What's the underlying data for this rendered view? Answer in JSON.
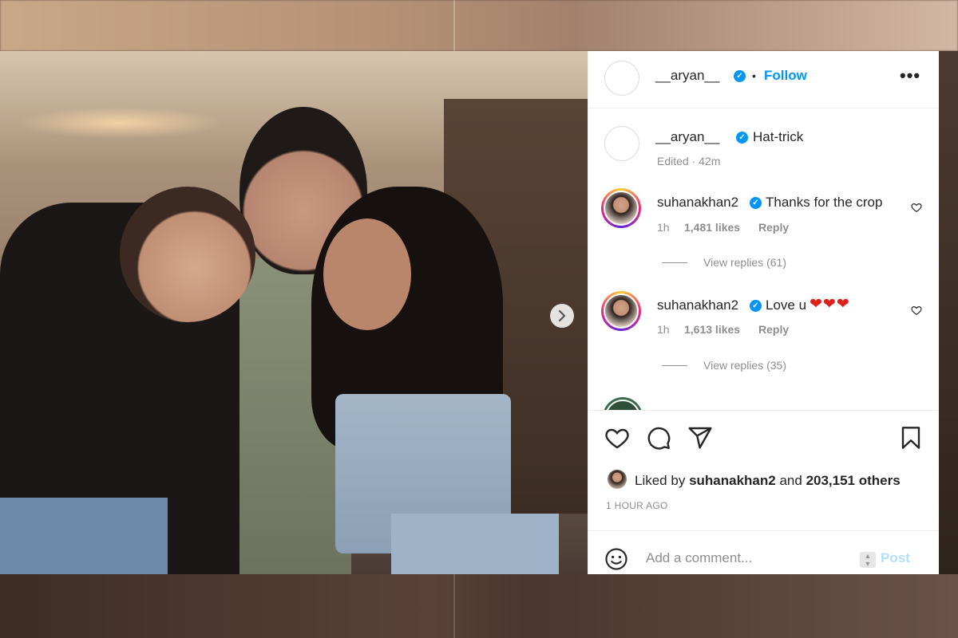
{
  "post": {
    "author": "__aryan__",
    "follow_label": "Follow",
    "bullet": "•",
    "more_label": "•••",
    "caption": {
      "username": "__aryan__",
      "text": "Hat-trick",
      "meta": "Edited · 42m"
    },
    "comments": [
      {
        "username": "suhanakhan2",
        "text": "Thanks for the crop",
        "time": "1h",
        "likes": "1,481 likes",
        "reply_label": "Reply",
        "view_replies": "View replies (61)"
      },
      {
        "username": "suhanakhan2",
        "text": "Love u",
        "hearts": "❤❤❤",
        "time": "1h",
        "likes": "1,613 likes",
        "reply_label": "Reply",
        "view_replies": "View replies (35)"
      }
    ],
    "liked_by": {
      "prefix": "Liked by",
      "user": "suhanakhan2",
      "middle": "and",
      "others": "203,151 others"
    },
    "time_ago": "1 HOUR AGO",
    "add_comment_placeholder": "Add a comment...",
    "post_label": "Post",
    "carousel": {
      "total_slides": 2,
      "current_slide": 1
    }
  },
  "colors": {
    "accent": "#0095f6",
    "text": "#262626",
    "muted": "#8e8e8e",
    "heart_red": "#e0211b"
  },
  "icons": [
    "more-icon",
    "verified-icon",
    "heart-icon",
    "comment-icon",
    "share-icon",
    "bookmark-icon",
    "emoji-icon",
    "chevron-right-icon"
  ]
}
